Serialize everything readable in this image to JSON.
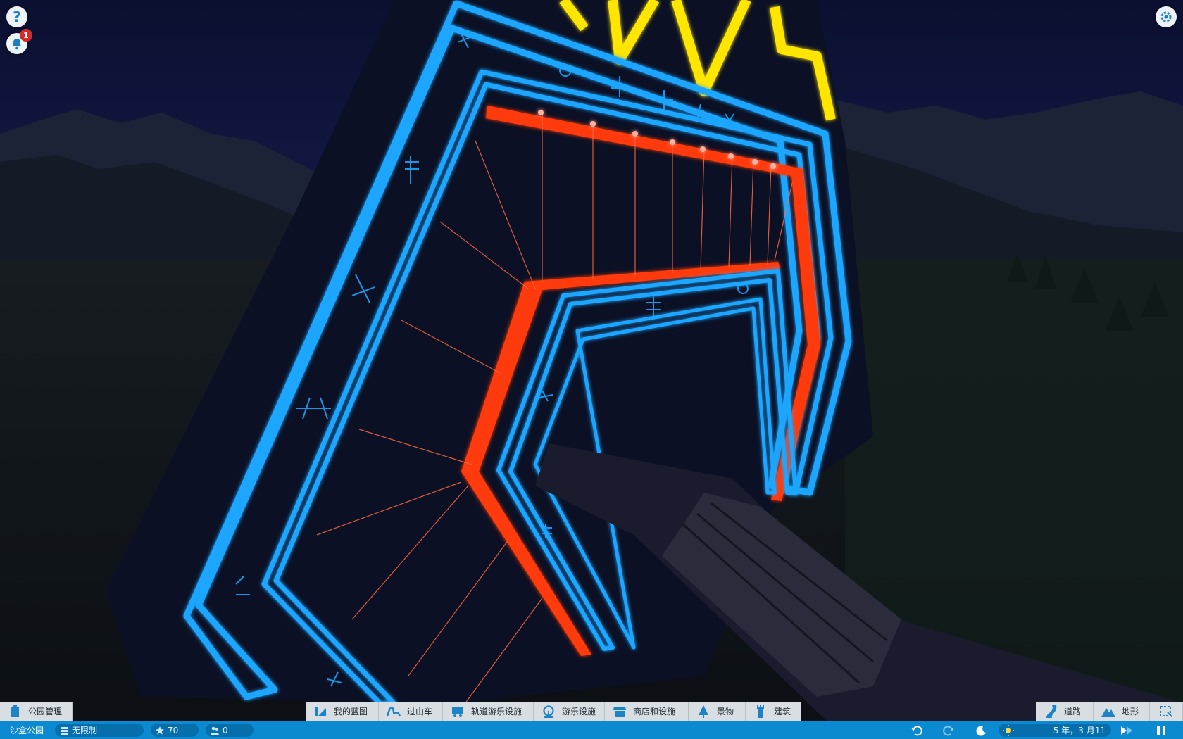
{
  "hud": {
    "help_label": "?",
    "notifications_count": "1"
  },
  "toolbar": {
    "park_management": "公园管理",
    "blueprints": "我的蓝图",
    "coasters": "过山车",
    "track_rides": "轨道游乐设施",
    "flat_rides": "游乐设施",
    "shops": "商店和设施",
    "scenery": "景物",
    "buildings": "建筑",
    "paths": "道路",
    "terrain": "地形"
  },
  "status": {
    "park_name": "沙盒公园",
    "money": "无限制",
    "rating": "70",
    "guests": "0",
    "date": "5 年，3 月11"
  },
  "colors": {
    "accent": "#0b8ad1",
    "neon_blue": "#1aa6ff",
    "neon_red": "#ff3a10",
    "neon_yellow": "#ffe600"
  }
}
